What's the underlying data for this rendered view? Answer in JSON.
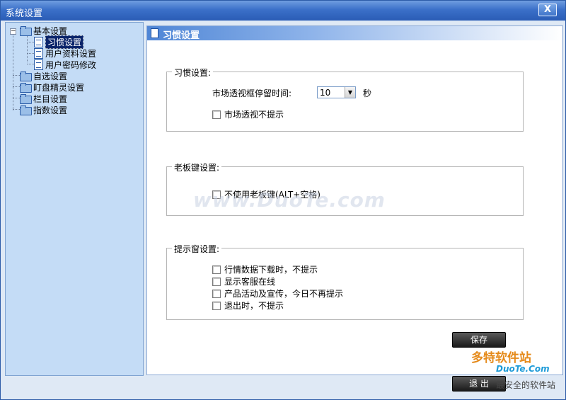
{
  "window": {
    "title": "系统设置",
    "close_label": "X"
  },
  "tree": {
    "collapse_glyph": "−",
    "items": [
      {
        "label": "基本设置"
      },
      {
        "label": "习惯设置"
      },
      {
        "label": "用户资料设置"
      },
      {
        "label": "用户密码修改"
      },
      {
        "label": "自选设置"
      },
      {
        "label": "盯盘精灵设置"
      },
      {
        "label": "栏目设置"
      },
      {
        "label": "指数设置"
      }
    ]
  },
  "panel": {
    "title": "习惯设置",
    "habit_group": {
      "legend": "习惯设置:",
      "stay_time_label": "市场透视框停留时间:",
      "stay_time_value": "10",
      "stay_time_unit": "秒",
      "no_prompt_label": "市场透视不提示"
    },
    "boss_group": {
      "legend": "老板键设置:",
      "no_boss_key_label": "不使用老板键(ALT+空格)"
    },
    "prompt_group": {
      "legend": "提示窗设置:",
      "options": [
        {
          "label": "行情数据下载时，不提示"
        },
        {
          "label": "显示客服在线"
        },
        {
          "label": "产品活动及宣传，今日不再提示"
        },
        {
          "label": "退出时，不提示"
        }
      ]
    },
    "save_label": "保存",
    "exit_label": "退 出"
  },
  "watermark": {
    "text": "www.DuoTe.com",
    "logo_text": "多特软件站",
    "logo_url": "DuoTe.Com",
    "logo_tagline": "最安全的软件站"
  }
}
